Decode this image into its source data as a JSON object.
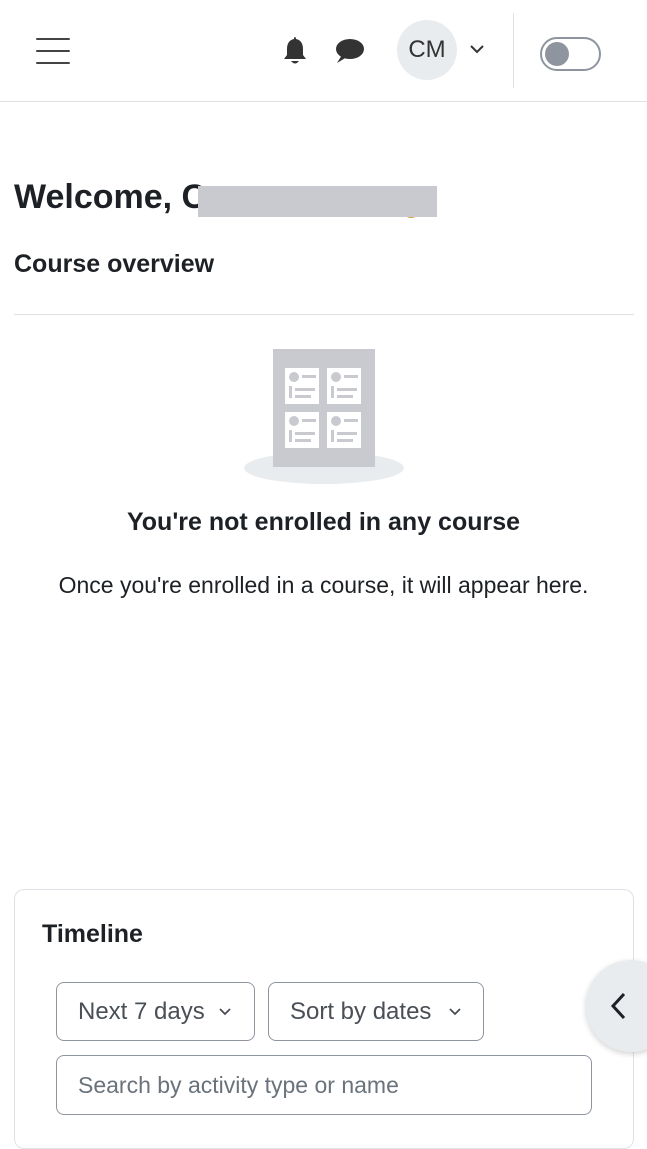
{
  "navbar": {
    "menu_icon": "hamburger-menu-icon",
    "notifications_icon": "bell-icon",
    "messages_icon": "chat-bubble-icon",
    "user_initials": "CM",
    "user_menu_icon": "chevron-down-icon",
    "edit_mode_toggle": "off"
  },
  "welcome": {
    "text": "Welcome, C"
  },
  "course_overview": {
    "title": "Course overview",
    "empty_title": "You're not enrolled in any course",
    "empty_description": "Once you're enrolled in a course, it will appear here."
  },
  "timeline": {
    "title": "Timeline",
    "range_select": "Next 7 days",
    "sort_select": "Sort by dates",
    "search_placeholder": "Search by activity type or name"
  },
  "drawer": {
    "toggle_icon": "chevron-left-icon"
  },
  "colors": {
    "border": "#dee2e6",
    "text": "#1d2125",
    "muted": "#8f959e",
    "illustration": "#c8cacf"
  }
}
